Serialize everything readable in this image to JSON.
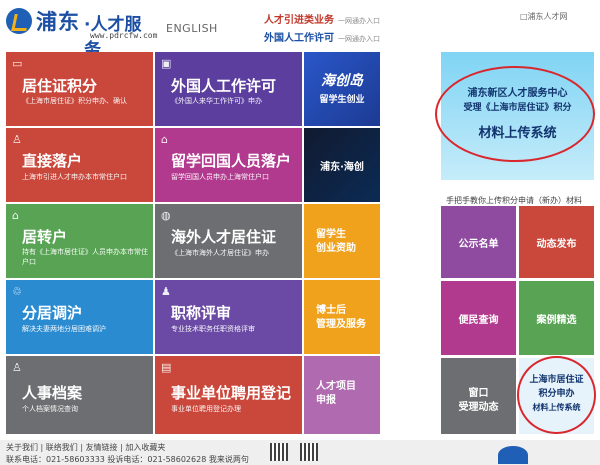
{
  "header": {
    "logo_brand": "浦东",
    "logo_service": "·人才服务",
    "logo_url": "www.pdrcfw.com",
    "english": "ENGLISH",
    "links": [
      {
        "label": "人才引进类业务",
        "sub": "一网通办入口"
      },
      {
        "label": "外国人工作许可",
        "sub": "一网通办入口"
      }
    ],
    "top_right": "□浦东人才网"
  },
  "tiles": [
    {
      "key": "residence-points",
      "title": "居住证积分",
      "subtitle": "《上海市居住证》积分申办、确认",
      "color": "#c9473b"
    },
    {
      "key": "foreign-work-permit",
      "title": "外国人工作许可",
      "subtitle": "《外国人来华工作许可》申办",
      "color": "#5c3e9e"
    },
    {
      "key": "direct-hukou",
      "title": "直接落户",
      "subtitle": "上海市引进人才申办本市常住户口",
      "color": "#c9473b"
    },
    {
      "key": "returnee-hukou",
      "title": "留学回国人员落户",
      "subtitle": "留学回国人员申办上海常住户口",
      "color": "#b23a8e"
    },
    {
      "key": "residence-to-hukou",
      "title": "居转户",
      "subtitle": "持有《上海市居住证》人员申办本市常住户口",
      "color": "#58a454"
    },
    {
      "key": "overseas-residence",
      "title": "海外人才居住证",
      "subtitle": "《上海市海外人才居住证》申办",
      "color": "#6d6e71"
    },
    {
      "key": "household-adjust",
      "title": "分居调沪",
      "subtitle": "解决夫妻两地分居困难调沪",
      "color": "#2b8bd1"
    },
    {
      "key": "title-review",
      "title": "职称评审",
      "subtitle": "专业技术职务任职资格评审",
      "color": "#6a4aa4"
    },
    {
      "key": "personnel-archive",
      "title": "人事档案",
      "subtitle": "个人档案情况查询",
      "color": "#6d6e71"
    },
    {
      "key": "public-employ",
      "title": "事业单位聘用登记",
      "subtitle": "事业单位聘用登记办理",
      "color": "#c9473b"
    }
  ],
  "small_tiles": [
    {
      "key": "study-startup",
      "line1": "留学生",
      "line2": "创业资助",
      "color": "#f0a21c"
    },
    {
      "key": "postdoc",
      "line1": "博士后",
      "line2": "管理及服务",
      "color": "#f0a21c"
    },
    {
      "key": "talent-project",
      "line1": "人才项目",
      "line2": "申报",
      "color": "#b06ab0"
    }
  ],
  "promos": {
    "haichuang_line1": "海创岛",
    "haichuang_line2": "留学生创业",
    "pudong_brand": "浦东·海创"
  },
  "banner": {
    "line1": "浦东新区人才服务中心",
    "line2": "受理《上海市居住证》积分",
    "line3": "材料上传系统"
  },
  "ticker": "手把手教你上传积分申请（新办）材料",
  "right_tiles": [
    {
      "key": "public-list",
      "label": "公示名单",
      "color": "#8e4b9f"
    },
    {
      "key": "news",
      "label": "动态发布",
      "color": "#c9473b"
    },
    {
      "key": "service-query",
      "label": "便民查询",
      "color": "#b23a8e"
    },
    {
      "key": "cases",
      "label": "案例精选",
      "color": "#58a454"
    },
    {
      "key": "window",
      "line1": "窗口",
      "line2": "受理动态",
      "color": "#6d6e71"
    },
    {
      "key": "residence-apply",
      "line1": "上海市居住证",
      "line2": "积分申办",
      "line3": "材料上传系统",
      "color": "#e6f3fb"
    }
  ],
  "footer": {
    "links": [
      "关于我们",
      "联络我们",
      "友情链接",
      "加入收藏夹"
    ],
    "line2": "联系电话：021-58603333    投诉电话：021-58602628    我来说两句"
  }
}
